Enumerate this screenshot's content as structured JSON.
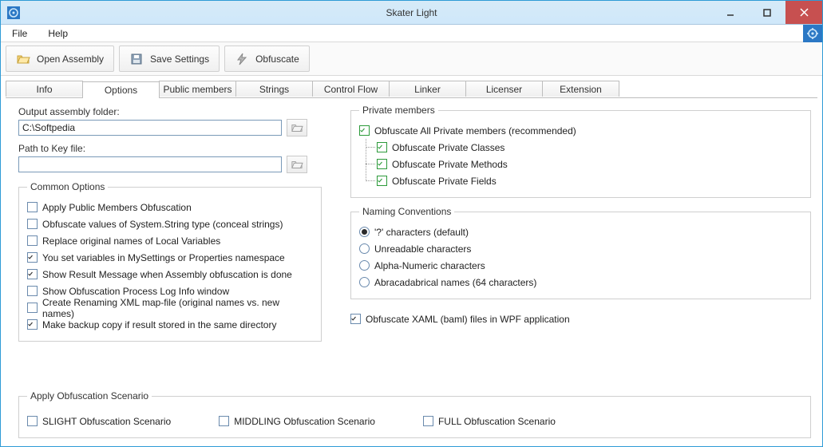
{
  "title": "Skater Light",
  "menu": {
    "file": "File",
    "help": "Help"
  },
  "toolbar": {
    "openAssembly": "Open Assembly",
    "saveSettings": "Save Settings",
    "obfuscate": "Obfuscate"
  },
  "tabs": [
    "Info",
    "Options",
    "Public members",
    "Strings",
    "Control Flow",
    "Linker",
    "Licenser",
    "Extension"
  ],
  "activeTab": "Options",
  "leftCol": {
    "outputLabel": "Output assembly folder:",
    "outputValue": "C:\\Softpedia",
    "keyLabel": "Path to Key file:",
    "keyValue": ""
  },
  "commonOptions": {
    "legend": "Common Options",
    "items": [
      {
        "label": "Apply Public Members Obfuscation",
        "checked": false
      },
      {
        "label": "Obfuscate values of System.String type (conceal strings)",
        "checked": false
      },
      {
        "label": "Replace original names of Local Variables",
        "checked": false
      },
      {
        "label": "You set variables in MySettings or Properties namespace",
        "checked": true
      },
      {
        "label": "Show Result Message when Assembly obfuscation is done",
        "checked": true
      },
      {
        "label": "Show Obfuscation Process Log Info window",
        "checked": false
      },
      {
        "label": "Create Renaming XML map-file (original names vs. new names)",
        "checked": false
      },
      {
        "label": "Make backup copy if result stored in the same directory",
        "checked": true
      }
    ]
  },
  "privateMembers": {
    "legend": "Private members",
    "root": {
      "label": "Obfuscate All Private members (recommended)",
      "checked": true
    },
    "children": [
      {
        "label": "Obfuscate Private Classes",
        "checked": true
      },
      {
        "label": "Obfuscate Private Methods",
        "checked": true
      },
      {
        "label": "Obfuscate Private Fields",
        "checked": true
      }
    ]
  },
  "naming": {
    "legend": "Naming Conventions",
    "options": [
      {
        "label": "'?' characters (default)",
        "selected": true
      },
      {
        "label": "Unreadable characters",
        "selected": false
      },
      {
        "label": "Alpha-Numeric characters",
        "selected": false
      },
      {
        "label": "Abracadabrical names (64 characters)",
        "selected": false
      }
    ]
  },
  "xamlOption": {
    "label": "Obfuscate XAML (baml) files in WPF application",
    "checked": true
  },
  "scenario": {
    "legend": "Apply Obfuscation Scenario",
    "items": [
      {
        "label": "SLIGHT Obfuscation Scenario",
        "checked": false
      },
      {
        "label": "MIDDLING Obfuscation Scenario",
        "checked": false
      },
      {
        "label": "FULL Obfuscation Scenario",
        "checked": false
      }
    ]
  }
}
